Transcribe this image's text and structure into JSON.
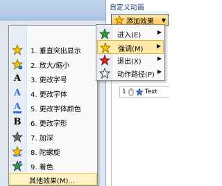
{
  "pane": {
    "title": "自定义动画",
    "add_effect_label": "添加效果",
    "add_effect_arrow": "▼"
  },
  "effect_list": {
    "row_number": "1",
    "row_text": "Text"
  },
  "submenu": {
    "items": [
      {
        "label": "进入(E)",
        "arrow": "▶",
        "icon": "entrance-star-icon"
      },
      {
        "label": "强调(M)",
        "arrow": "▶",
        "icon": "emphasis-star-icon"
      },
      {
        "label": "退出(X)",
        "arrow": "▶",
        "icon": "exit-star-icon"
      },
      {
        "label": "动作路径(P)",
        "arrow": "▶",
        "icon": "motion-path-star-icon"
      }
    ],
    "active_index": 1
  },
  "menu": {
    "items": [
      {
        "label": "1. 垂直突出显示",
        "icon": "star-icon"
      },
      {
        "label": "2. 放大/缩小",
        "icon": "star-icon"
      },
      {
        "label": "3. 更改字号",
        "icon": "font-size-icon",
        "glyph": "A"
      },
      {
        "label": "4. 更改字体",
        "icon": "font-icon",
        "glyph": "A"
      },
      {
        "label": "5. 更改字体颜色",
        "icon": "font-color-icon",
        "glyph": "A"
      },
      {
        "label": "6. 更改字形",
        "icon": "bold-icon",
        "glyph": "B"
      },
      {
        "label": "7. 加深",
        "icon": "star-icon"
      },
      {
        "label": "8. 陀螺旋",
        "icon": "star-icon"
      },
      {
        "label": "9. 着色",
        "icon": "star-icon"
      }
    ],
    "more_label": "其他效果(M)..."
  },
  "colors": {
    "accent_border": "#2f6ab7",
    "highlight": "#ffe9a6",
    "star_yellow": "#f5c400",
    "star_blue": "#2d6fd0",
    "star_green": "#2e9a3a",
    "star_red": "#d62a1e"
  }
}
